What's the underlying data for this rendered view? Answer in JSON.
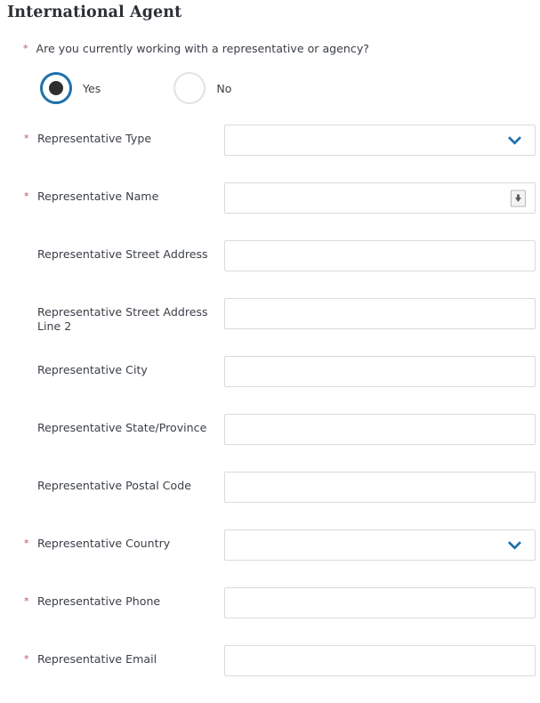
{
  "section": {
    "title": "International Agent"
  },
  "radio_question": {
    "required": true,
    "required_mark": "*",
    "text": "Are you currently working with a representative or agency?",
    "options": [
      {
        "label": "Yes",
        "selected": true
      },
      {
        "label": "No",
        "selected": false
      }
    ]
  },
  "colors": {
    "required_asterisk": "#b4565a",
    "radio_selected_ring": "#1f6fab",
    "radio_selected_dot": "#2f2f2f",
    "radio_unselected_ring": "#e2e2e2",
    "chevron_blue": "#1f6fab",
    "field_border": "#dcdcdc",
    "label_text": "#3a3f47",
    "title_text": "#2b2f36"
  },
  "fields": [
    {
      "label": "Representative Type",
      "required": true,
      "required_mark": "*",
      "control": "select",
      "value": "",
      "icon": "chevron-down-icon"
    },
    {
      "label": "Representative Name",
      "required": true,
      "required_mark": "*",
      "control": "text",
      "value": "",
      "icon": "lookup-icon"
    },
    {
      "label": "Representative Street Address",
      "required": false,
      "required_mark": "",
      "control": "text",
      "value": "",
      "icon": ""
    },
    {
      "label": "Representative Street Address Line 2",
      "required": false,
      "required_mark": "",
      "control": "text",
      "value": "",
      "icon": ""
    },
    {
      "label": "Representative City",
      "required": false,
      "required_mark": "",
      "control": "text",
      "value": "",
      "icon": ""
    },
    {
      "label": "Representative State/Province",
      "required": false,
      "required_mark": "",
      "control": "text",
      "value": "",
      "icon": ""
    },
    {
      "label": "Representative Postal Code",
      "required": false,
      "required_mark": "",
      "control": "text",
      "value": "",
      "icon": ""
    },
    {
      "label": "Representative Country",
      "required": true,
      "required_mark": "*",
      "control": "select",
      "value": "",
      "icon": "chevron-down-icon"
    },
    {
      "label": "Representative Phone",
      "required": true,
      "required_mark": "*",
      "control": "text",
      "value": "",
      "icon": ""
    },
    {
      "label": "Representative Email",
      "required": true,
      "required_mark": "*",
      "control": "text",
      "value": "",
      "icon": ""
    }
  ]
}
